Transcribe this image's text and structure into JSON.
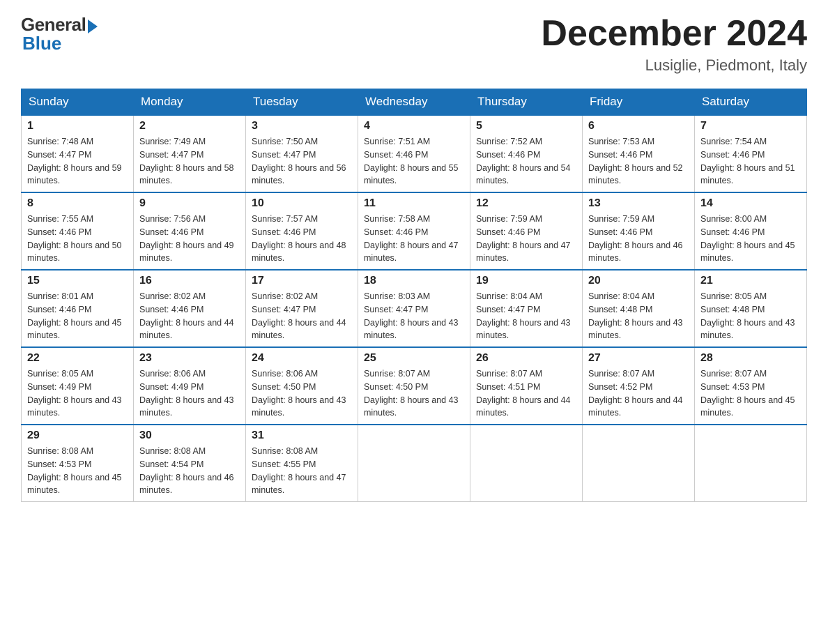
{
  "header": {
    "logo_general": "General",
    "logo_blue": "Blue",
    "month_title": "December 2024",
    "location": "Lusiglie, Piedmont, Italy"
  },
  "days_of_week": [
    "Sunday",
    "Monday",
    "Tuesday",
    "Wednesday",
    "Thursday",
    "Friday",
    "Saturday"
  ],
  "weeks": [
    [
      {
        "day": "1",
        "sunrise": "7:48 AM",
        "sunset": "4:47 PM",
        "daylight": "8 hours and 59 minutes."
      },
      {
        "day": "2",
        "sunrise": "7:49 AM",
        "sunset": "4:47 PM",
        "daylight": "8 hours and 58 minutes."
      },
      {
        "day": "3",
        "sunrise": "7:50 AM",
        "sunset": "4:47 PM",
        "daylight": "8 hours and 56 minutes."
      },
      {
        "day": "4",
        "sunrise": "7:51 AM",
        "sunset": "4:46 PM",
        "daylight": "8 hours and 55 minutes."
      },
      {
        "day": "5",
        "sunrise": "7:52 AM",
        "sunset": "4:46 PM",
        "daylight": "8 hours and 54 minutes."
      },
      {
        "day": "6",
        "sunrise": "7:53 AM",
        "sunset": "4:46 PM",
        "daylight": "8 hours and 52 minutes."
      },
      {
        "day": "7",
        "sunrise": "7:54 AM",
        "sunset": "4:46 PM",
        "daylight": "8 hours and 51 minutes."
      }
    ],
    [
      {
        "day": "8",
        "sunrise": "7:55 AM",
        "sunset": "4:46 PM",
        "daylight": "8 hours and 50 minutes."
      },
      {
        "day": "9",
        "sunrise": "7:56 AM",
        "sunset": "4:46 PM",
        "daylight": "8 hours and 49 minutes."
      },
      {
        "day": "10",
        "sunrise": "7:57 AM",
        "sunset": "4:46 PM",
        "daylight": "8 hours and 48 minutes."
      },
      {
        "day": "11",
        "sunrise": "7:58 AM",
        "sunset": "4:46 PM",
        "daylight": "8 hours and 47 minutes."
      },
      {
        "day": "12",
        "sunrise": "7:59 AM",
        "sunset": "4:46 PM",
        "daylight": "8 hours and 47 minutes."
      },
      {
        "day": "13",
        "sunrise": "7:59 AM",
        "sunset": "4:46 PM",
        "daylight": "8 hours and 46 minutes."
      },
      {
        "day": "14",
        "sunrise": "8:00 AM",
        "sunset": "4:46 PM",
        "daylight": "8 hours and 45 minutes."
      }
    ],
    [
      {
        "day": "15",
        "sunrise": "8:01 AM",
        "sunset": "4:46 PM",
        "daylight": "8 hours and 45 minutes."
      },
      {
        "day": "16",
        "sunrise": "8:02 AM",
        "sunset": "4:46 PM",
        "daylight": "8 hours and 44 minutes."
      },
      {
        "day": "17",
        "sunrise": "8:02 AM",
        "sunset": "4:47 PM",
        "daylight": "8 hours and 44 minutes."
      },
      {
        "day": "18",
        "sunrise": "8:03 AM",
        "sunset": "4:47 PM",
        "daylight": "8 hours and 43 minutes."
      },
      {
        "day": "19",
        "sunrise": "8:04 AM",
        "sunset": "4:47 PM",
        "daylight": "8 hours and 43 minutes."
      },
      {
        "day": "20",
        "sunrise": "8:04 AM",
        "sunset": "4:48 PM",
        "daylight": "8 hours and 43 minutes."
      },
      {
        "day": "21",
        "sunrise": "8:05 AM",
        "sunset": "4:48 PM",
        "daylight": "8 hours and 43 minutes."
      }
    ],
    [
      {
        "day": "22",
        "sunrise": "8:05 AM",
        "sunset": "4:49 PM",
        "daylight": "8 hours and 43 minutes."
      },
      {
        "day": "23",
        "sunrise": "8:06 AM",
        "sunset": "4:49 PM",
        "daylight": "8 hours and 43 minutes."
      },
      {
        "day": "24",
        "sunrise": "8:06 AM",
        "sunset": "4:50 PM",
        "daylight": "8 hours and 43 minutes."
      },
      {
        "day": "25",
        "sunrise": "8:07 AM",
        "sunset": "4:50 PM",
        "daylight": "8 hours and 43 minutes."
      },
      {
        "day": "26",
        "sunrise": "8:07 AM",
        "sunset": "4:51 PM",
        "daylight": "8 hours and 44 minutes."
      },
      {
        "day": "27",
        "sunrise": "8:07 AM",
        "sunset": "4:52 PM",
        "daylight": "8 hours and 44 minutes."
      },
      {
        "day": "28",
        "sunrise": "8:07 AM",
        "sunset": "4:53 PM",
        "daylight": "8 hours and 45 minutes."
      }
    ],
    [
      {
        "day": "29",
        "sunrise": "8:08 AM",
        "sunset": "4:53 PM",
        "daylight": "8 hours and 45 minutes."
      },
      {
        "day": "30",
        "sunrise": "8:08 AM",
        "sunset": "4:54 PM",
        "daylight": "8 hours and 46 minutes."
      },
      {
        "day": "31",
        "sunrise": "8:08 AM",
        "sunset": "4:55 PM",
        "daylight": "8 hours and 47 minutes."
      },
      null,
      null,
      null,
      null
    ]
  ]
}
